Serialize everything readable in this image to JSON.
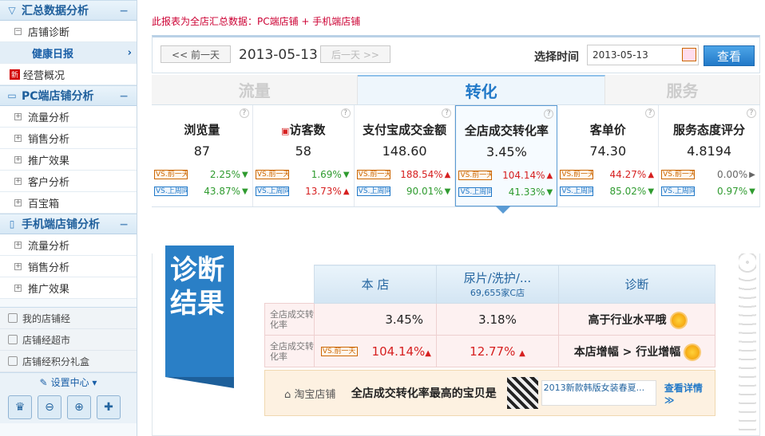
{
  "sidebar": {
    "sections": [
      {
        "title": "汇总数据分析",
        "icon": "filter-icon",
        "items": [
          {
            "label": "店铺诊断",
            "type": "parent"
          },
          {
            "label": "健康日报",
            "type": "sub",
            "arrow": "›"
          },
          {
            "label": "经营概况",
            "type": "new",
            "badge": "新"
          }
        ]
      },
      {
        "title": "PC端店铺分析",
        "icon": "monitor-icon",
        "items": [
          {
            "label": "流量分析"
          },
          {
            "label": "销售分析"
          },
          {
            "label": "推广效果"
          },
          {
            "label": "客户分析"
          },
          {
            "label": "百宝箱"
          }
        ]
      },
      {
        "title": "手机端店铺分析",
        "icon": "mobile-icon",
        "items": [
          {
            "label": "流量分析"
          },
          {
            "label": "销售分析"
          },
          {
            "label": "推广效果"
          }
        ]
      }
    ],
    "tools": [
      "我的店铺经",
      "店铺经超市",
      "店铺经积分礼盒"
    ],
    "settings_label": "设置中心 ▾",
    "settings_buttons": [
      "chef-icon",
      "user-minus-icon",
      "user-add-icon",
      "user-plus-icon"
    ]
  },
  "main": {
    "note": "此报表为全店汇总数据：PC端店铺 + 手机端店铺",
    "prev_btn": "<< 前一天",
    "next_btn": "后一天 >>",
    "current_date": "2013-05-13",
    "select_time_label": "选择时间",
    "date_input_value": "2013-05-13",
    "view_btn": "查看",
    "tabs": [
      "流量",
      "转化",
      "服务"
    ],
    "active_tab": 1,
    "metrics": [
      {
        "name": "浏览量",
        "value": "87",
        "c1": "2.25%",
        "d1": "down",
        "c2": "43.87%",
        "d2": "down"
      },
      {
        "name": "访客数",
        "value": "58",
        "c1": "1.69%",
        "d1": "down",
        "c2": "13.73%",
        "d2": "up",
        "icon": "visitor-icon"
      },
      {
        "name": "支付宝成交金额",
        "value": "148.60",
        "c1": "188.54%",
        "d1": "up",
        "c2": "90.01%",
        "d2": "down"
      },
      {
        "name": "全店成交转化率",
        "value": "3.45%",
        "c1": "104.14%",
        "d1": "up",
        "c2": "41.33%",
        "d2": "down",
        "active": true
      },
      {
        "name": "客单价",
        "value": "74.30",
        "c1": "44.27%",
        "d1": "up",
        "c2": "85.02%",
        "d2": "down"
      },
      {
        "name": "服务态度评分",
        "value": "4.8194",
        "c1": "0.00%",
        "d1": "flat",
        "c2": "0.97%",
        "d2": "down"
      }
    ],
    "tag_prev": "VS.前一天",
    "tag_week": "VS.上周同期",
    "diag": {
      "badge": "诊断结果",
      "headers": {
        "store": "本 店",
        "industry": "尿片/洗护/...",
        "industry_sub": "69,655家C店",
        "diagnosis": "诊断"
      },
      "rows": [
        {
          "label": "全店成交转化率",
          "store": "3.45%",
          "industry": "3.18%",
          "diagnosis": "高于行业水平哦"
        },
        {
          "label": "全店成交转化率",
          "tag": "VS.前一天",
          "store": "104.14%",
          "industry": "12.77%",
          "diagnosis": "本店增幅 > 行业增幅"
        }
      ],
      "taobao_label": "淘宝店铺",
      "taobao_text": "全店成交转化率最高的宝贝是",
      "product_name": "2013新款韩版女装春夏...",
      "more": "查看详情 ≫"
    }
  }
}
